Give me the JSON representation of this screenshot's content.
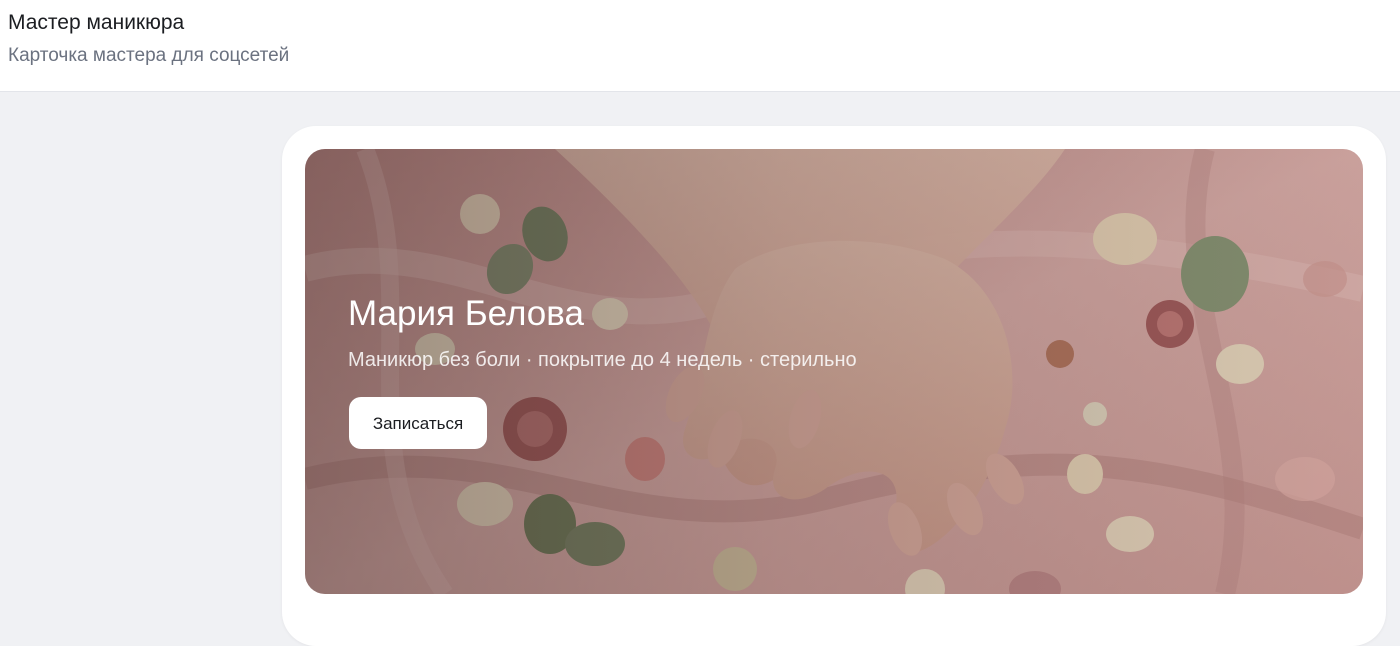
{
  "header": {
    "title": "Мастер маникюра",
    "subtitle": "Карточка мастера для соцсетей"
  },
  "card": {
    "hero": {
      "image": "manicure-hands-flowers-photo",
      "name": "Мария Белова",
      "tagline": "Маникюр без боли · покрытие до 4 недель · стерильно",
      "button_label": "Записаться"
    }
  },
  "colors": {
    "page_bg": "#f0f1f4",
    "card_bg": "#ffffff",
    "silk": "#d9a9a6",
    "button_bg": "#ffffff"
  }
}
